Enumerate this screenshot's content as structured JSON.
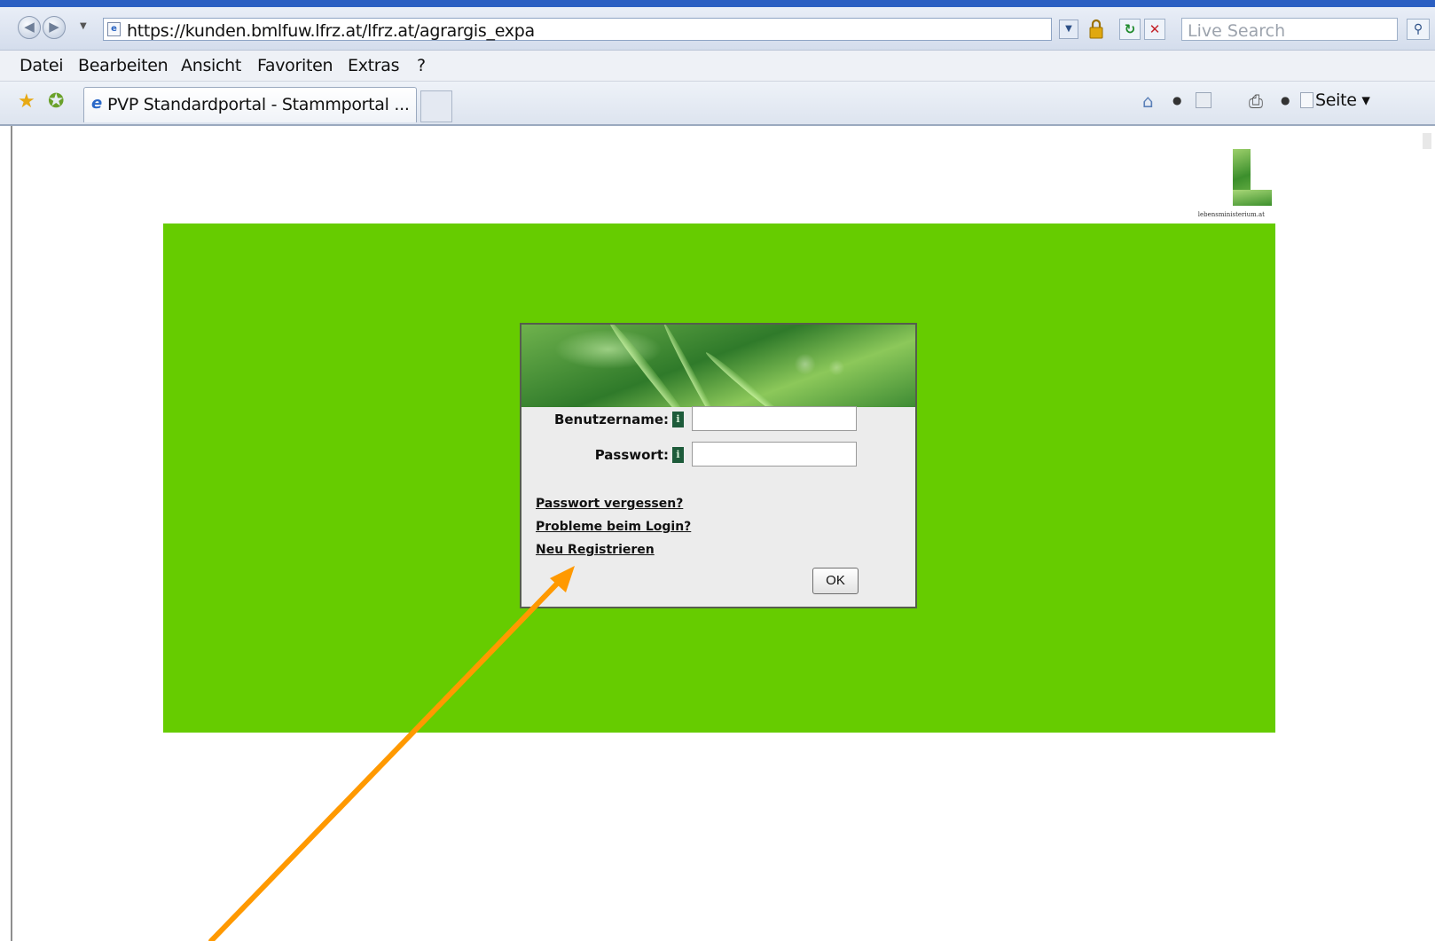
{
  "browser": {
    "url": "https://kunden.bmlfuw.lfrz.at/lfrz.at/agrargis_expa",
    "search_placeholder": "Live Search",
    "menu": [
      "Datei",
      "Bearbeiten",
      "Ansicht",
      "Favoriten",
      "Extras",
      "?"
    ],
    "tab_title": "PVP Standardportal - Stammportal ...",
    "page_menu_label": "Seite"
  },
  "logo": {
    "caption": "lebensministerium.at"
  },
  "login": {
    "username_label": "Benutzername:",
    "password_label": "Passwort:",
    "info_glyph": "i",
    "username_value": "",
    "password_value": "",
    "links": [
      "Passwort vergessen?",
      "Probleme beim Login?",
      "Neu Registrieren"
    ],
    "ok_label": "OK"
  },
  "colors": {
    "panel_green": "#66cc00",
    "arrow_orange": "#ff9900"
  }
}
